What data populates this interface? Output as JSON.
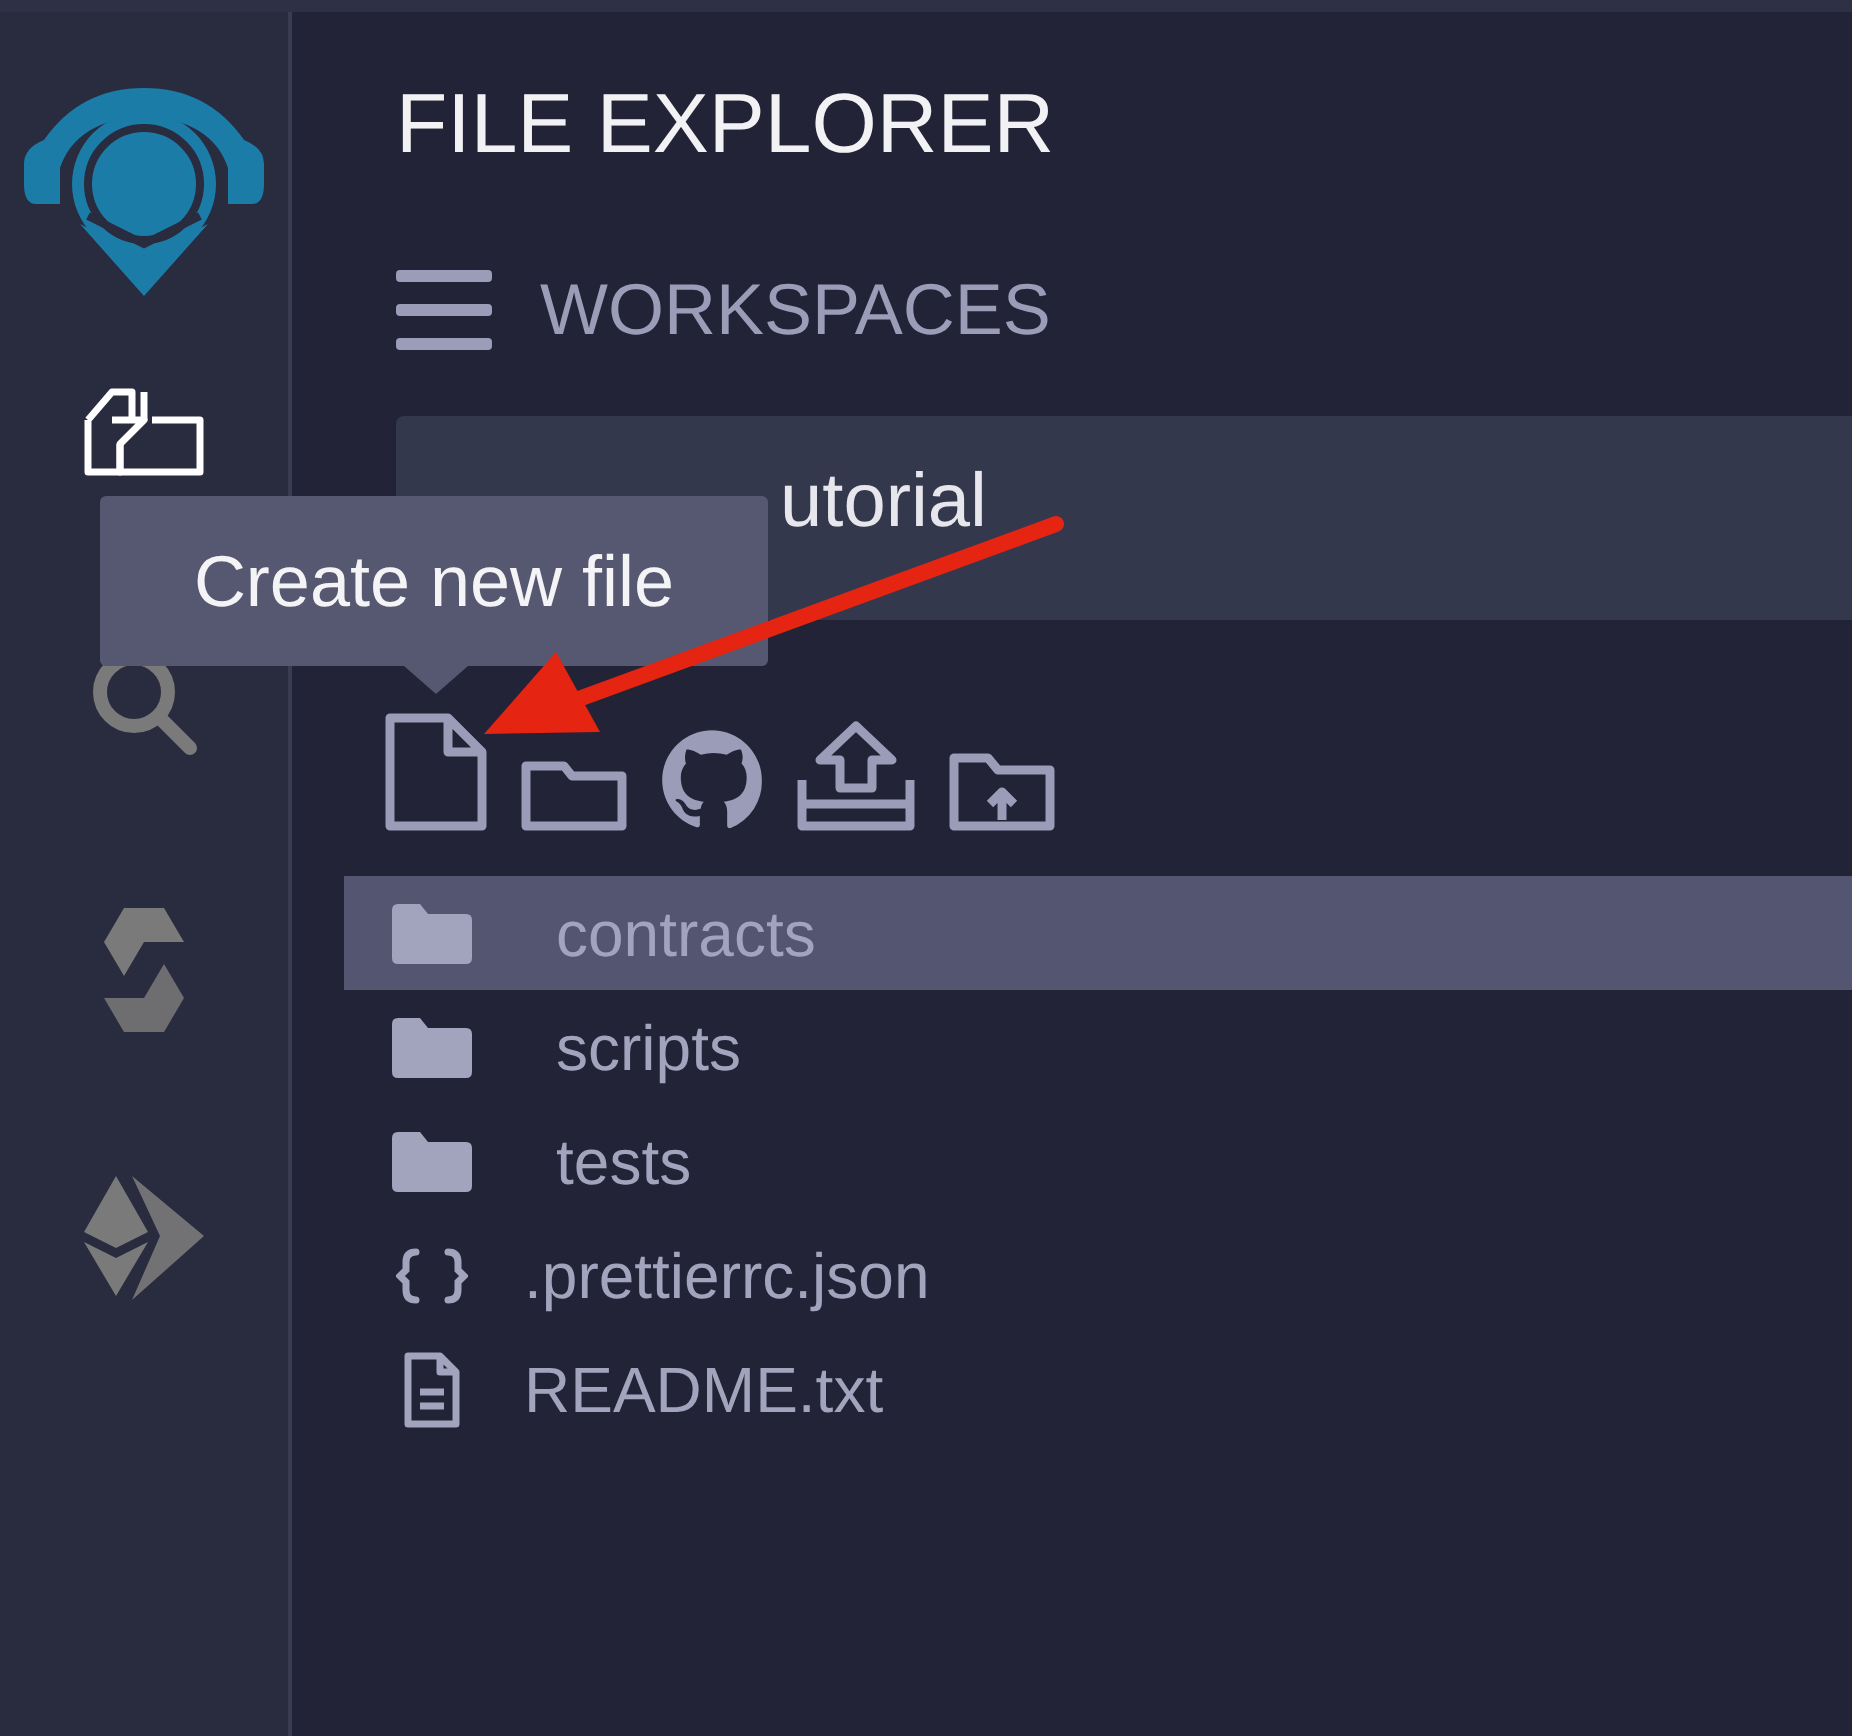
{
  "sidebar": [
    {
      "kind": "files",
      "selected": true
    },
    {
      "kind": "search",
      "selected": false
    },
    {
      "kind": "solidity",
      "selected": false
    },
    {
      "kind": "deploy",
      "selected": false
    }
  ],
  "panel": {
    "title": "FILE EXPLORER",
    "workspaces_label": "WORKSPACES",
    "workspace": "utorial"
  },
  "tooltip": "Create new file",
  "tree": [
    {
      "name": "contracts",
      "kind": "folder",
      "selected": true
    },
    {
      "name": "scripts",
      "kind": "folder",
      "selected": false
    },
    {
      "name": "tests",
      "kind": "folder",
      "selected": false
    },
    {
      "name": ".prettierrc.json",
      "kind": "json",
      "selected": false
    },
    {
      "name": "README.txt",
      "kind": "text",
      "selected": false
    }
  ]
}
